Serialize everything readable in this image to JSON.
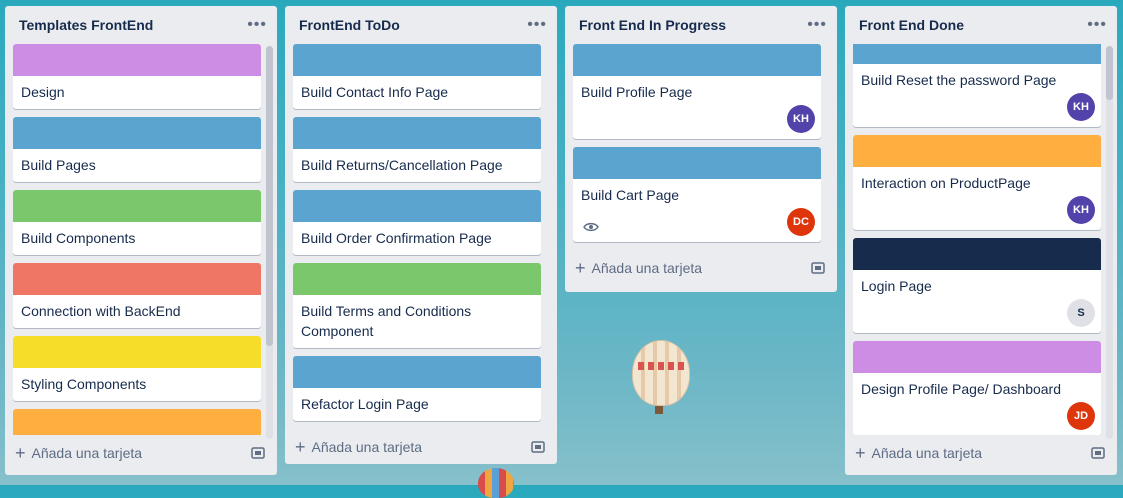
{
  "colors": {
    "purple": "#cd8de5",
    "blue": "#5ba4cf",
    "green": "#7bc86c",
    "red": "#ef7564",
    "yellow": "#f5dd29",
    "orange": "#ffaf3f",
    "navy": "#172b4d"
  },
  "add_card_label": "Añada una tarjeta",
  "lists": [
    {
      "title": "Templates FrontEnd",
      "cards": [
        {
          "title": "Design"
        },
        {
          "title": "Build Pages"
        },
        {
          "title": "Build Components"
        },
        {
          "title": "Connection with BackEnd"
        },
        {
          "title": "Styling Components"
        }
      ]
    },
    {
      "title": "FrontEnd ToDo",
      "cards": [
        {
          "title": "Build Contact Info Page"
        },
        {
          "title": "Build Returns/Cancellation Page"
        },
        {
          "title": "Build Order Confirmation Page"
        },
        {
          "title": "Build Terms and Conditions Component"
        },
        {
          "title": "Refactor Login Page"
        }
      ]
    },
    {
      "title": "Front End In Progress",
      "cards": [
        {
          "title": "Build Profile Page",
          "member": "KH"
        },
        {
          "title": "Build Cart Page",
          "member": "DC",
          "badge_icon": "eye-icon"
        }
      ]
    },
    {
      "title": "Front End Done",
      "cards": [
        {
          "title": "Build Reset the password Page",
          "member": "KH"
        },
        {
          "title": "Interaction on ProductPage",
          "member": "KH"
        },
        {
          "title": "Login Page",
          "member": "S"
        },
        {
          "title": "Design Profile Page/ Dashboard",
          "member": "JD"
        }
      ]
    }
  ]
}
